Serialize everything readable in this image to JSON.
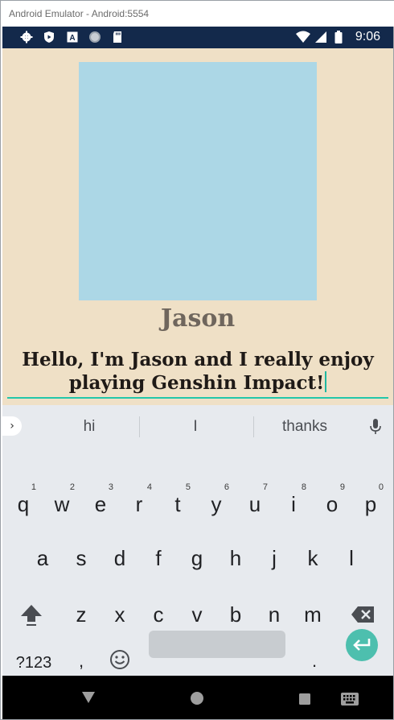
{
  "window": {
    "title": "Android Emulator - Android:5554"
  },
  "statusbar": {
    "time": "9:06",
    "icons": [
      "settings-icon",
      "play-protect-icon",
      "a-box-icon",
      "circle-icon",
      "sd-card-icon",
      "wifi-icon",
      "signal-icon",
      "battery-icon"
    ],
    "colors": {
      "background": "#13294b",
      "foreground": "#ffffff"
    }
  },
  "profile": {
    "name": "Jason",
    "bio": "Hello, I'm Jason and I really enjoy playing Genshin Impact!",
    "avatar_color": "#acd7e6",
    "background_color": "#efe0c6",
    "accent_color": "#23c7aa"
  },
  "keyboard": {
    "suggestions": [
      "hi",
      "I",
      "thanks"
    ],
    "row1": [
      {
        "key": "q",
        "hint": "1"
      },
      {
        "key": "w",
        "hint": "2"
      },
      {
        "key": "e",
        "hint": "3"
      },
      {
        "key": "r",
        "hint": "4"
      },
      {
        "key": "t",
        "hint": "5"
      },
      {
        "key": "y",
        "hint": "6"
      },
      {
        "key": "u",
        "hint": "7"
      },
      {
        "key": "i",
        "hint": "8"
      },
      {
        "key": "o",
        "hint": "9"
      },
      {
        "key": "p",
        "hint": "0"
      }
    ],
    "row2": [
      "a",
      "s",
      "d",
      "f",
      "g",
      "h",
      "j",
      "k",
      "l"
    ],
    "row3": [
      "z",
      "x",
      "c",
      "v",
      "b",
      "n",
      "m"
    ],
    "row4": {
      "symbols": "?123",
      "comma": ",",
      "period": "."
    },
    "enter_color": "#4dbfae"
  },
  "navbar": {
    "icons": [
      "back-icon",
      "home-icon",
      "recents-icon",
      "keyboard-icon"
    ]
  }
}
